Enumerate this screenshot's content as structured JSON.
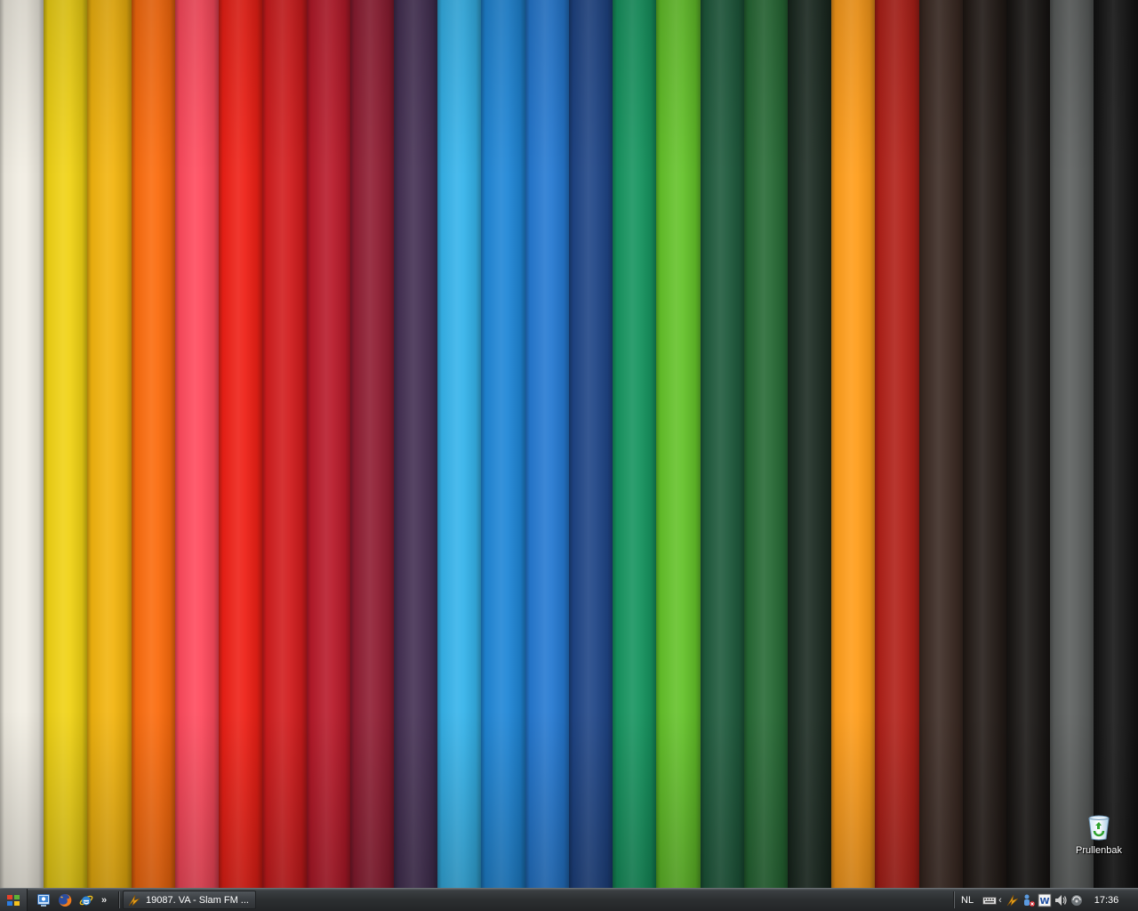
{
  "desktop": {
    "wallpaper": {
      "description_colors": [
        "#f1ede2",
        "#f0d214",
        "#f2b40e",
        "#fb6b0d",
        "#ff4a5d",
        "#ee2016",
        "#d11c1d",
        "#b81a2a",
        "#8f1d32",
        "#443053",
        "#35b3ea",
        "#1f86d6",
        "#2579d1",
        "#1f4586",
        "#16945f",
        "#64c22a",
        "#1e5a3c",
        "#276a35",
        "#1c2b22",
        "#ff9d1a",
        "#b12018",
        "#3b2a23",
        "#241c18",
        "#1a1715",
        "#5b5e5d",
        "#151515"
      ]
    },
    "icons": [
      {
        "label": "Prullenbak",
        "icon": "recycle-bin-icon"
      }
    ]
  },
  "taskbar": {
    "start": {
      "icon": "start-orb-icon"
    },
    "quick_launch": [
      {
        "icon": "show-desktop-icon"
      },
      {
        "icon": "firefox-icon"
      },
      {
        "icon": "internet-explorer-icon"
      }
    ],
    "quick_launch_more": "»",
    "task_items": [
      {
        "label": "19087. VA - Slam FM ...",
        "icon": "winamp-icon"
      }
    ],
    "tray": {
      "language": "NL",
      "chevron": "‹",
      "icons": [
        "keyboard-icon",
        "winamp-tray-icon",
        "network-user-icon",
        "word-icon",
        "volume-icon",
        "monitor-icon"
      ],
      "clock": "17:36"
    }
  }
}
